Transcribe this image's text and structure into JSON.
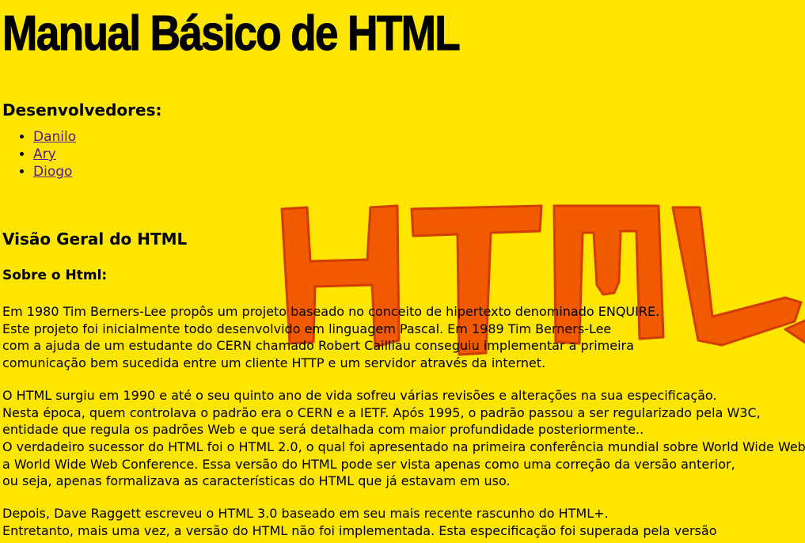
{
  "page": {
    "title": "Manual Básico de HTML",
    "developers_heading": "Desenvolvedores:",
    "developers": [
      "Danilo",
      "Ary",
      "Diogo"
    ],
    "overview_heading": "Visão Geral do HTML",
    "about_heading": "Sobre o Html:",
    "paragraph1": [
      "Em 1980 Tim Berners-Lee propôs um projeto baseado no conceito de hipertexto denominado ENQUIRE.",
      "Este projeto foi inicialmente todo desenvolvido em linguagem Pascal. Em 1989 Tim Berners-Lee",
      "com a ajuda de um estudante do CERN chamado Robert Cailliau conseguiu implementar a primeira",
      "comunicação bem sucedida entre um cliente HTTP e um servidor através da internet."
    ],
    "paragraph2": [
      "O HTML surgiu em 1990 e até o seu quinto ano de vida sofreu várias revisões e alterações na sua especificação.",
      "Nesta época, quem controlava o padrão era o CERN e a IETF. Após 1995, o padrão passou a ser regularizado pela W3C,",
      "entidade que regula os padrões Web e que será detalhada com maior profundidade posteriormente..",
      "O verdadeiro sucessor do HTML foi o HTML 2.0, o qual foi apresentado na primeira conferência mundial sobre World Wide Web,",
      "a World Wide Web Conference. Essa versão do HTML pode ser vista apenas como uma correção da versão anterior,",
      "ou seja, apenas formalizava as características do HTML que já estavam em uso."
    ],
    "paragraph3": [
      "Depois, Dave Raggett escreveu o HTML 3.0 baseado em seu mais recente rascunho do HTML+.",
      "Entretanto, mais uma vez, a versão do HTML não foi implementada. Esta especificação foi superada pela versão"
    ]
  },
  "logo": {
    "fill": "#F25A00",
    "stroke": "#D13D00",
    "icon": "html-logo-icon"
  },
  "colors": {
    "background": "#FFE600",
    "link": "#551A8B"
  }
}
